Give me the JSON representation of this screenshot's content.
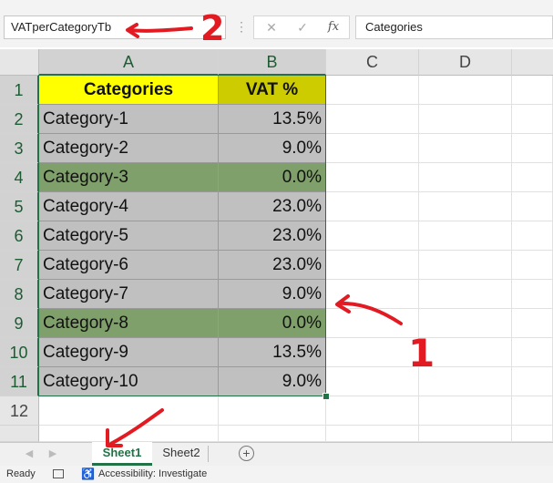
{
  "formula_bar": {
    "name_box": "VATperCategoryTb",
    "separator": "⋮",
    "cancel_icon": "✕",
    "enter_icon": "✓",
    "fx_icon": "fx",
    "formula_value": "Categories"
  },
  "columns": [
    "A",
    "B",
    "C",
    "D"
  ],
  "rows": [
    "1",
    "2",
    "3",
    "4",
    "5",
    "6",
    "7",
    "8",
    "9",
    "10",
    "11",
    "12"
  ],
  "table": {
    "headers": [
      "Categories",
      "VAT %"
    ],
    "rows": [
      [
        "Category-1",
        "13.5%"
      ],
      [
        "Category-2",
        "9.0%"
      ],
      [
        "Category-3",
        "0.0%"
      ],
      [
        "Category-4",
        "23.0%"
      ],
      [
        "Category-5",
        "23.0%"
      ],
      [
        "Category-6",
        "23.0%"
      ],
      [
        "Category-7",
        "9.0%"
      ],
      [
        "Category-8",
        "0.0%"
      ],
      [
        "Category-9",
        "13.5%"
      ],
      [
        "Category-10",
        "9.0%"
      ]
    ]
  },
  "colors": {
    "header_a": "#ffff00",
    "header_b": "#cccc00",
    "row_gray": "#c0c0c0",
    "row_highlight": "#7f9f6b",
    "accent": "#217346",
    "annotation": "#e21b23"
  },
  "sheet_tabs": {
    "active": "Sheet1",
    "other": "Sheet2",
    "prev_icon": "◀",
    "next_icon": "▶",
    "add_icon": "+"
  },
  "status_bar": {
    "ready": "Ready",
    "accessibility": "Accessibility: Investigate"
  },
  "annotations": {
    "label_1": "1",
    "label_2": "2"
  }
}
